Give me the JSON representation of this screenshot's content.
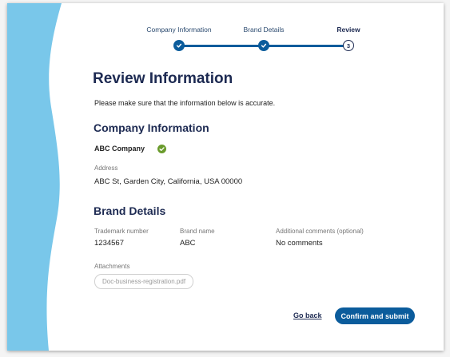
{
  "stepper": {
    "steps": [
      {
        "label": "Company Information",
        "state": "done"
      },
      {
        "label": "Brand Details",
        "state": "done"
      },
      {
        "label": "Review",
        "state": "current",
        "number": "3"
      }
    ]
  },
  "page": {
    "title": "Review Information",
    "intro": "Please make sure that the information below is accurate."
  },
  "company": {
    "heading": "Company Information",
    "name": "ABC Company",
    "verified_icon": "check-circle-icon",
    "address_label": "Address",
    "address_value": "ABC St, Garden City, California, USA 00000"
  },
  "brand": {
    "heading": "Brand Details",
    "trademark_label": "Trademark number",
    "trademark_value": "1234567",
    "brand_name_label": "Brand name",
    "brand_name_value": "ABC",
    "comments_label": "Additional comments (optional)",
    "comments_value": "No comments",
    "attachments_label": "Attachments",
    "attachment_file": "Doc-business-registration.pdf"
  },
  "actions": {
    "go_back": "Go back",
    "confirm": "Confirm and submit"
  },
  "colors": {
    "primary": "#0b5c9c",
    "heading": "#1d2a52",
    "accent_wave": "#79c7ea",
    "success": "#6a9b2c"
  }
}
